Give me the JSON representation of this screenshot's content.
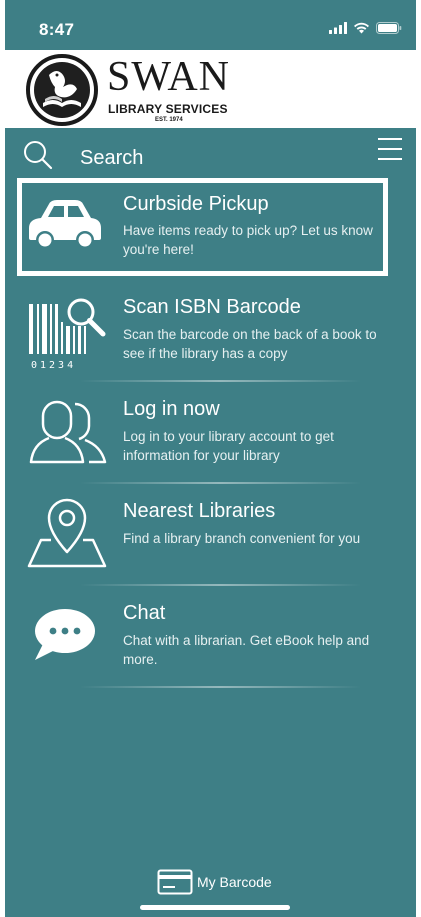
{
  "status_bar": {
    "time": "8:47",
    "signal_icon": "cellular-signal-icon",
    "wifi_icon": "wifi-icon",
    "battery_icon": "battery-icon"
  },
  "brand": {
    "name": "SWAN",
    "subtitle": "LIBRARY SERVICES",
    "established": "EST. 1974",
    "logo_icon": "swan-book-logo-icon"
  },
  "search": {
    "label": "Search",
    "icon": "search-icon",
    "menu_icon": "hamburger-menu-icon"
  },
  "menu": {
    "items": [
      {
        "title": "Curbside Pickup",
        "description": "Have items ready to pick up? Let us know you're here!",
        "icon": "car-icon",
        "highlighted": true
      },
      {
        "title": "Scan ISBN Barcode",
        "description": "Scan the barcode on the back of a book to see if the library has a copy",
        "icon": "barcode-scan-icon",
        "barcode_digits": "01234"
      },
      {
        "title": "Log in now",
        "description": "Log in to your library account to get information for your library",
        "icon": "users-icon"
      },
      {
        "title": "Nearest Libraries",
        "description": "Find a library branch convenient for you",
        "icon": "map-pin-icon"
      },
      {
        "title": "Chat",
        "description": "Chat with a librarian. Get eBook help and more.",
        "icon": "chat-bubble-icon"
      }
    ]
  },
  "bottom": {
    "barcode_label": "My Barcode",
    "barcode_icon": "card-icon"
  },
  "colors": {
    "background": "#3e7f86",
    "header_background": "#ffffff",
    "text": "#ffffff"
  }
}
